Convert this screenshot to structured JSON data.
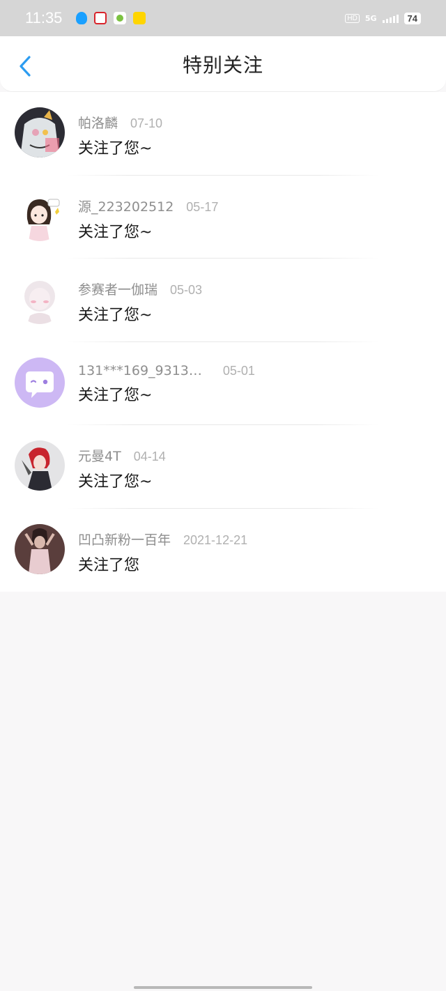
{
  "status_bar": {
    "time": "11:35",
    "network": "5G",
    "hd": "HD",
    "battery": "74"
  },
  "header": {
    "title": "特别关注",
    "back_icon": "chevron-left-icon",
    "accent_color": "#2c9cf0"
  },
  "items": [
    {
      "name": "帕洛麟",
      "date": "07-10",
      "message": "关注了您~"
    },
    {
      "name": "源_223202512",
      "date": "05-17",
      "message": "关注了您~"
    },
    {
      "name": "参赛者一伽瑞",
      "date": "05-03",
      "message": "关注了您~"
    },
    {
      "name": "131***169_9313…",
      "date": "05-01",
      "message": "关注了您~"
    },
    {
      "name": "元曼4T",
      "date": "04-14",
      "message": "关注了您~"
    },
    {
      "name": "凹凸新粉一百年",
      "date": "2021-12-21",
      "message": "关注了您"
    }
  ]
}
